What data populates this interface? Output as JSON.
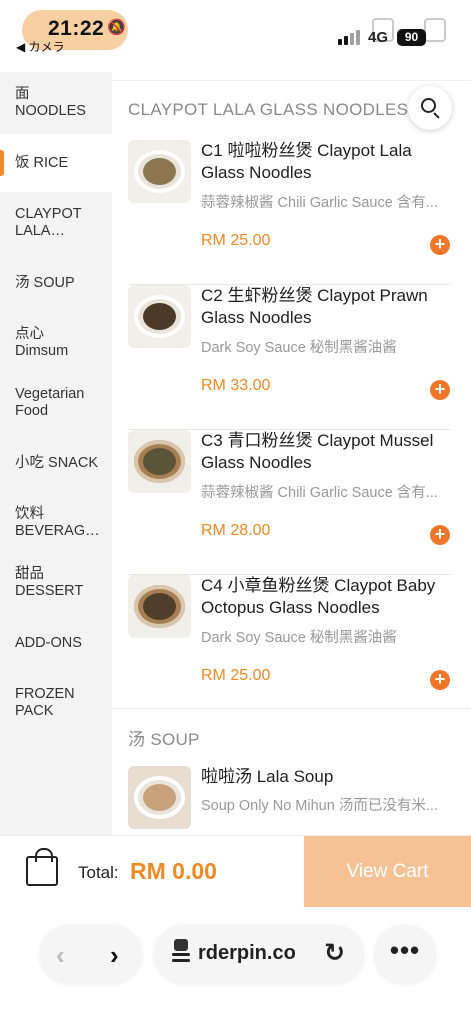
{
  "status_bar": {
    "time": "21:22",
    "back_app": "◀ カメラ",
    "network": "4G",
    "battery": "90"
  },
  "sidebar": {
    "items": [
      {
        "label": "面\nNOODLES",
        "active": false
      },
      {
        "label": "饭 RICE",
        "active": true
      },
      {
        "label": "CLAYPOT\nLALA…",
        "active": false
      },
      {
        "label": "汤 SOUP",
        "active": false
      },
      {
        "label": "点心\nDimsum",
        "active": false
      },
      {
        "label": "Vegetarian\nFood",
        "active": false
      },
      {
        "label": "小吃 SNACK",
        "active": false
      },
      {
        "label": "饮料\nBEVERAG…",
        "active": false
      },
      {
        "label": "甜品\nDESSERT",
        "active": false
      },
      {
        "label": "ADD-ONS",
        "active": false
      },
      {
        "label": "FROZEN\nPACK",
        "active": false
      }
    ]
  },
  "main": {
    "section1_title": "CLAYPOT LALA GLASS NOODLES",
    "items": [
      {
        "name": "C1 啦啦粉丝煲 Claypot Lala Glass Noodles",
        "desc": "蒜蓉辣椒酱 Chili Garlic Sauce 含有...",
        "price": "RM 25.00",
        "add": "+"
      },
      {
        "name": "C2 生虾粉丝煲 Claypot Prawn Glass Noodles",
        "desc": "Dark Soy Sauce 秘制黑酱油酱",
        "price": "RM 33.00",
        "add": "+"
      },
      {
        "name": "C3 青口粉丝煲 Claypot Mussel Glass Noodles",
        "desc": "蒜蓉辣椒酱 Chili Garlic Sauce 含有...",
        "price": "RM 28.00",
        "add": "+"
      },
      {
        "name": "C4 小章鱼粉丝煲 Claypot Baby Octopus Glass Noodles",
        "desc": "Dark Soy Sauce 秘制黑酱油酱",
        "price": "RM 25.00",
        "add": "+"
      }
    ],
    "section2_title": "汤 SOUP",
    "soup_item": {
      "name": "啦啦汤 Lala Soup",
      "desc": "Soup Only No Mihun 汤而已没有米..."
    }
  },
  "cart": {
    "total_label": "Total:",
    "total_value": "RM 0.00",
    "view_cart": "View Cart"
  },
  "browser": {
    "url": "rderpin.co",
    "back": "‹",
    "forward": "›",
    "reload": "↻",
    "more": "•••"
  }
}
